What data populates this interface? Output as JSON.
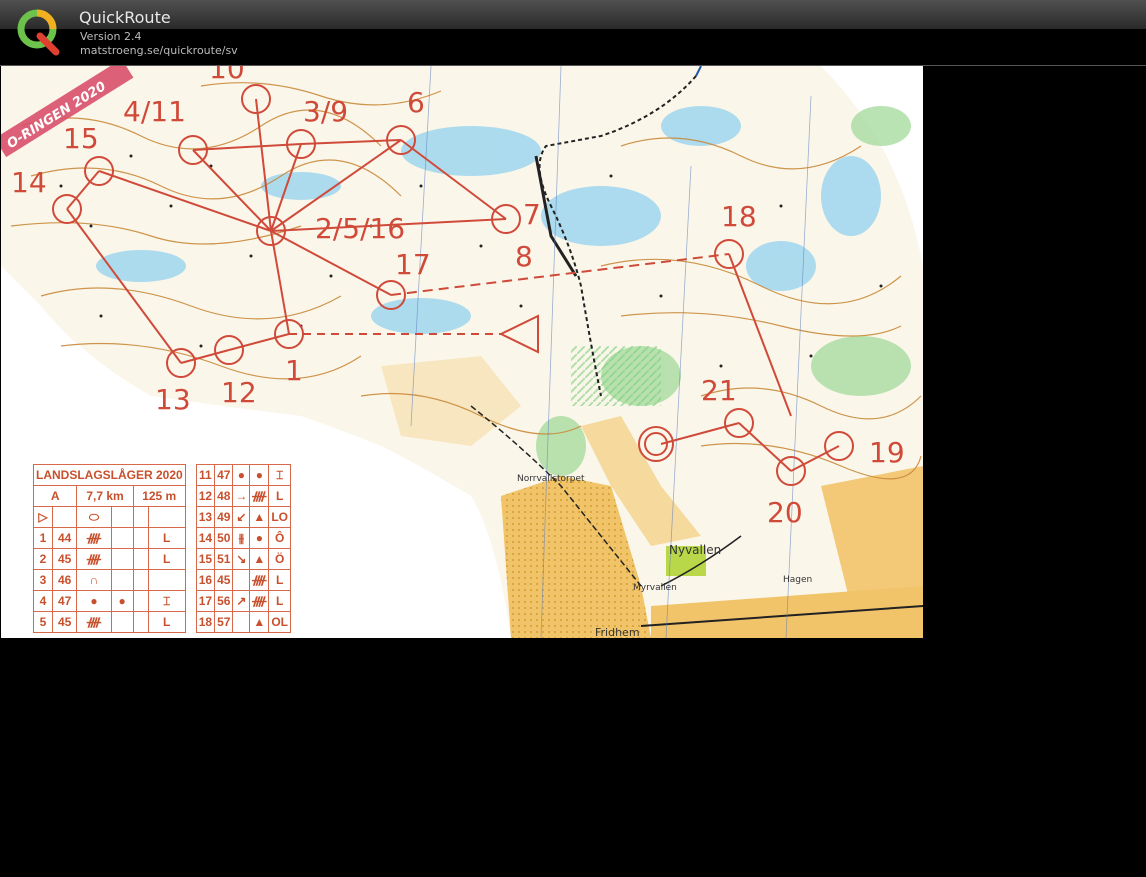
{
  "app": {
    "title": "QuickRoute",
    "version": "Version 2.4",
    "site": "matstroeng.se/quickroute/sv"
  },
  "map": {
    "stamp": "O-RINGEN 2020",
    "place_names": [
      "Norrvallstorpet",
      "Nyvallen",
      "Myrvallen",
      "Fridhem",
      "Hagen"
    ],
    "control_labels": [
      {
        "text": "10"
      },
      {
        "text": "4/11"
      },
      {
        "text": "3/9"
      },
      {
        "text": "6"
      },
      {
        "text": "15"
      },
      {
        "text": "14"
      },
      {
        "text": "7"
      },
      {
        "text": "18"
      },
      {
        "text": "2/5/16"
      },
      {
        "text": "8"
      },
      {
        "text": "17"
      },
      {
        "text": "1"
      },
      {
        "text": "12"
      },
      {
        "text": "13"
      },
      {
        "text": "21"
      },
      {
        "text": "19"
      },
      {
        "text": "20"
      }
    ],
    "colors": {
      "course": "#d04a3a",
      "contour": "#c98a3a",
      "open_land": "#f4c676",
      "water": "#7fc8e8",
      "forest_green": "#8fd08a",
      "paper": "#ffffff"
    }
  },
  "description_sheet": {
    "title": "LANDSLAGSLÅGER 2020",
    "class": "A",
    "length": "7,7 km",
    "climb": "125 m",
    "left_rows": [
      {
        "no": "1",
        "code": "44",
        "sym": "ᚎ",
        "det": "",
        "pos": "L"
      },
      {
        "no": "2",
        "code": "45",
        "sym": "ᚎ",
        "det": "",
        "pos": "L"
      },
      {
        "no": "3",
        "code": "46",
        "sym": "∩",
        "det": "",
        "pos": ""
      },
      {
        "no": "4",
        "code": "47",
        "sym": "●",
        "det": "●",
        "pos": "⌶"
      },
      {
        "no": "5",
        "code": "45",
        "sym": "ᚎ",
        "det": "",
        "pos": "L"
      }
    ],
    "right_rows": [
      {
        "no": "11",
        "code": "47",
        "sym": "●",
        "det": "●",
        "pos": "⌶"
      },
      {
        "no": "12",
        "code": "48",
        "sym": "→",
        "det": "ᚎ",
        "pos": "L"
      },
      {
        "no": "13",
        "code": "49",
        "sym": "↙",
        "det": "▲",
        "pos": "LO"
      },
      {
        "no": "14",
        "code": "50",
        "sym": "⫵",
        "det": "●",
        "pos": "Ô"
      },
      {
        "no": "15",
        "code": "51",
        "sym": "↘",
        "det": "▲",
        "pos": "Ö"
      },
      {
        "no": "16",
        "code": "45",
        "sym": "",
        "det": "ᚎ",
        "pos": "L"
      },
      {
        "no": "17",
        "code": "56",
        "sym": "↗",
        "det": "ᚎ",
        "pos": "L"
      },
      {
        "no": "18",
        "code": "57",
        "sym": "",
        "det": "▲",
        "pos": "OL"
      }
    ],
    "start_symbol": "▷"
  }
}
